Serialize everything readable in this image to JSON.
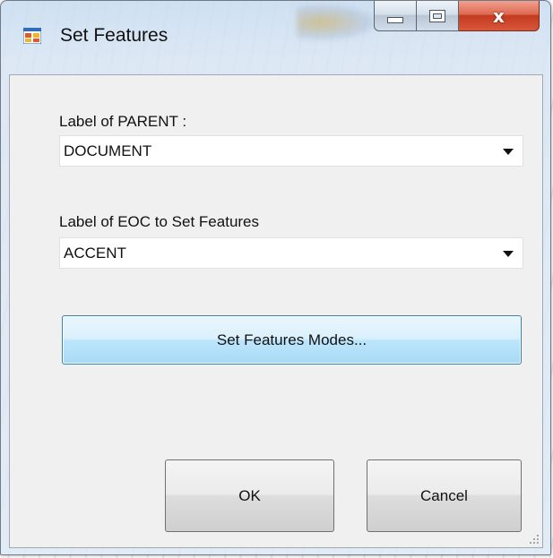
{
  "window": {
    "title": "Set Features",
    "icon": "app-form-icon",
    "caption_buttons": [
      "minimize",
      "maximize",
      "close"
    ],
    "close_glyph": "x"
  },
  "form": {
    "parent_label": "Label of PARENT :",
    "parent_value": "DOCUMENT",
    "eoc_label": "Label of EOC to Set Features",
    "eoc_value": "ACCENT",
    "modes_button": "Set Features Modes...",
    "ok_button": "OK",
    "cancel_button": "Cancel"
  },
  "colors": {
    "focus_button_border": "#3c7fb1",
    "close_button": "#c43a1f"
  }
}
